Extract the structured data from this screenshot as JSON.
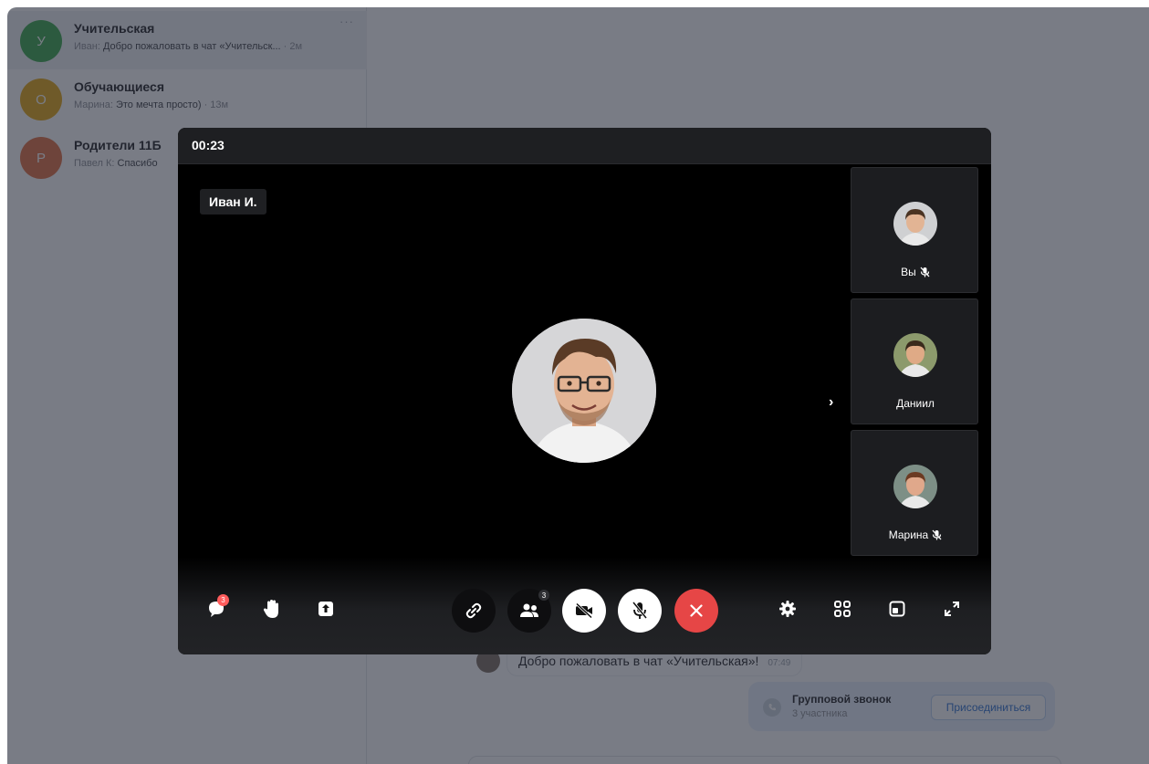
{
  "chats": [
    {
      "avatar_letter": "У",
      "avatar_color": "#36a749",
      "title": "Учительская",
      "author": "Иван:",
      "preview": "Добро пожаловать в чат «Учительск...",
      "time": "· 2м",
      "active": true
    },
    {
      "avatar_letter": "О",
      "avatar_color": "#e5a70e",
      "title": "Обучающиеся",
      "author": "Марина:",
      "preview": "Это мечта просто)",
      "time": "· 13м",
      "active": false
    },
    {
      "avatar_letter": "Р",
      "avatar_color": "#e26d3e",
      "title": "Родители 11Б",
      "author": "Павел К:",
      "preview": "Спасибо",
      "time": "",
      "active": false
    }
  ],
  "chat_more": "···",
  "message": {
    "text": "Добро пожаловать в чат «Учительская»!",
    "time": "07:49"
  },
  "call_card": {
    "title": "Групповой звонок",
    "subtitle": "3 участника",
    "join_label": "Присоединиться"
  },
  "call": {
    "timer": "00:23",
    "speaker_name": "Иван И.",
    "participants": [
      {
        "name": "Вы",
        "muted": true,
        "hair": "#4a3322",
        "skin": "#e2b494",
        "bg": "#cfd0d2"
      },
      {
        "name": "Даниил",
        "muted": false,
        "hair": "#3a2a1c",
        "skin": "#dfaa86",
        "bg": "#8c9a6c"
      },
      {
        "name": "Марина",
        "muted": true,
        "hair": "#6b3a22",
        "skin": "#e0a88b",
        "bg": "#7d8f86"
      }
    ],
    "participants_count": "3",
    "chat_badge": "3"
  },
  "icons": {
    "chat": "chat-bubble-icon",
    "hand": "raise-hand-icon",
    "share": "screen-share-icon",
    "link": "link-icon",
    "people": "participants-icon",
    "camera": "camera-off-icon",
    "mic": "mic-off-icon",
    "end": "end-call-icon",
    "settings": "gear-icon",
    "grid": "grid-layout-icon",
    "pip": "picture-in-picture-icon",
    "fullscreen": "fullscreen-icon"
  },
  "colors": {
    "end_call": "#e64646",
    "badge": "#ff5c5c",
    "accent": "#2a6ecf"
  }
}
